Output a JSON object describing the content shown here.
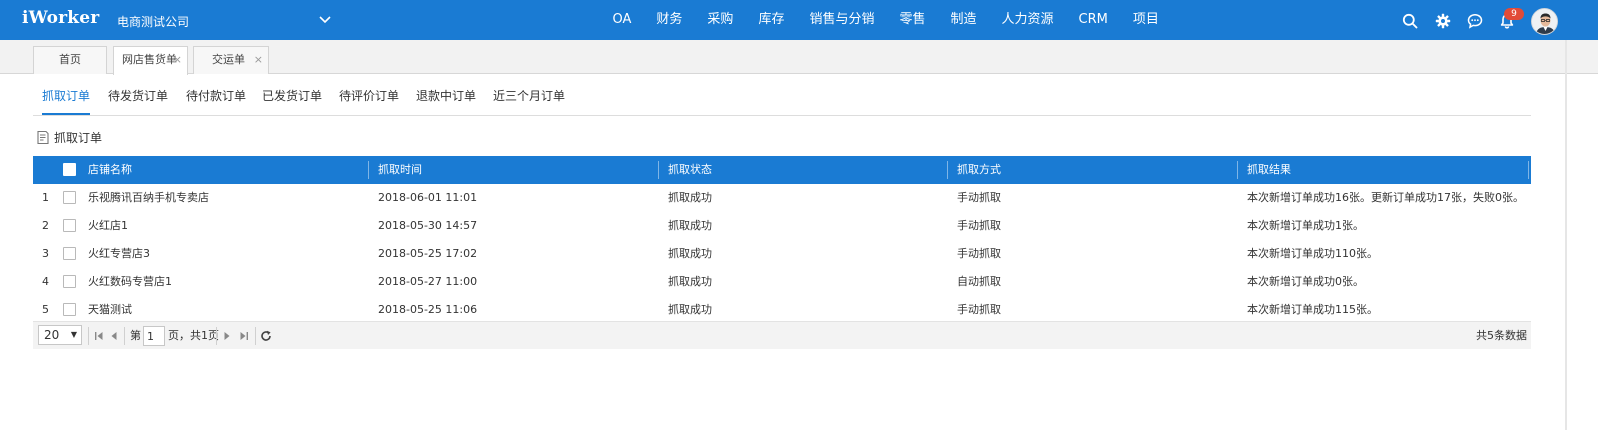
{
  "app": {
    "logo": "iWorker",
    "company": "电商测试公司",
    "notification_count": "9"
  },
  "nav": {
    "items": [
      "OA",
      "财务",
      "采购",
      "库存",
      "销售与分销",
      "零售",
      "制造",
      "人力资源",
      "CRM",
      "项目"
    ]
  },
  "page_tabs": [
    {
      "label": "首页",
      "closable": false,
      "active": false
    },
    {
      "label": "网店售货单",
      "closable": true,
      "active": true
    },
    {
      "label": "交运单",
      "closable": true,
      "active": false
    }
  ],
  "sub_tabs": [
    "抓取订单",
    "待发货订单",
    "待付款订单",
    "已发货订单",
    "待评价订单",
    "退款中订单",
    "近三个月订单"
  ],
  "action": {
    "label": "抓取订单"
  },
  "table": {
    "columns": [
      "店铺名称",
      "抓取时间",
      "抓取状态",
      "抓取方式",
      "抓取结果"
    ],
    "rows": [
      {
        "num": "1",
        "shop": "乐视腾讯百纳手机专卖店",
        "time": "2018-06-01 11:01",
        "status": "抓取成功",
        "method": "手动抓取",
        "result": "本次新增订单成功16张。更新订单成功17张，失败0张。"
      },
      {
        "num": "2",
        "shop": "火红店1",
        "time": "2018-05-30 14:57",
        "status": "抓取成功",
        "method": "手动抓取",
        "result": "本次新增订单成功1张。"
      },
      {
        "num": "3",
        "shop": "火红专营店3",
        "time": "2018-05-25 17:02",
        "status": "抓取成功",
        "method": "手动抓取",
        "result": "本次新增订单成功110张。"
      },
      {
        "num": "4",
        "shop": "火红数码专营店1",
        "time": "2018-05-27 11:00",
        "status": "抓取成功",
        "method": "自动抓取",
        "result": "本次新增订单成功0张。"
      },
      {
        "num": "5",
        "shop": "天猫测试",
        "time": "2018-05-25 11:06",
        "status": "抓取成功",
        "method": "手动抓取",
        "result": "本次新增订单成功115张。"
      }
    ]
  },
  "pager": {
    "page_size": "20",
    "page_prefix": "第",
    "page_value": "1",
    "page_suffix": "页，共1页",
    "total": "共5条数据"
  },
  "colors": {
    "brand": "#1a7bd3",
    "badge": "#e24b38"
  },
  "icons": {
    "search": "search-icon",
    "settings": "gear-icon",
    "chat": "chat-icon",
    "notifications": "bell-icon"
  }
}
